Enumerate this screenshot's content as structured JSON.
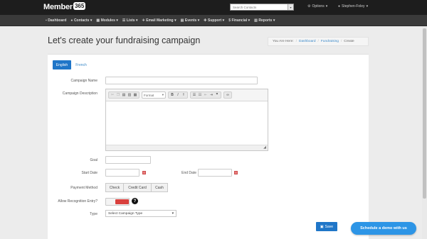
{
  "app": {
    "logo_text": "Member",
    "logo_badge": "365"
  },
  "topbar": {
    "search_placeholder": "Search Contacts",
    "options_label": "Options",
    "user_label": "Stephen-Foley"
  },
  "nav": {
    "items": [
      {
        "label": "Dashboard",
        "icon": "dashboard-icon",
        "caret": false
      },
      {
        "label": "Contacts",
        "icon": "contacts-icon",
        "caret": true
      },
      {
        "label": "Modules",
        "icon": "modules-icon",
        "caret": true
      },
      {
        "label": "Lists",
        "icon": "lists-icon",
        "caret": true
      },
      {
        "label": "Email Marketing",
        "icon": "email-marketing-icon",
        "caret": true
      },
      {
        "label": "Events",
        "icon": "events-icon",
        "caret": true
      },
      {
        "label": "Support",
        "icon": "support-icon",
        "caret": true
      },
      {
        "label": "Financial",
        "icon": "financial-icon",
        "caret": true
      },
      {
        "label": "Reports",
        "icon": "reports-icon",
        "caret": true
      }
    ]
  },
  "page": {
    "title": "Let's create your fundraising campaign",
    "breadcrumb": {
      "prefix": "You Are Here:",
      "items": [
        "Dashboard",
        "Fundraising",
        "Create"
      ]
    }
  },
  "tabs": {
    "english": "English",
    "french": "French"
  },
  "form": {
    "campaign_name_label": "Campaign Name",
    "campaign_description_label": "Campaign Description",
    "format_label": "Format",
    "goal_label": "Goal",
    "start_date_label": "Start Date",
    "end_date_label": "End Date",
    "payment_method_label": "Payment Method",
    "payment_methods": [
      "Check",
      "Credit Card",
      "Cash"
    ],
    "allow_recognition_label": "Allow Recognition Entry?",
    "type_label": "Type",
    "type_placeholder": "Select Campaign Type",
    "save_label": "Save"
  },
  "widgets": {
    "demo_label": "Schedule a demo with us"
  },
  "colors": {
    "primary": "#1f76c8",
    "toggle_on": "#d9403d",
    "demo": "#2d95e6",
    "topbar": "#1d1d1d",
    "navbar": "#3a3a3a"
  }
}
